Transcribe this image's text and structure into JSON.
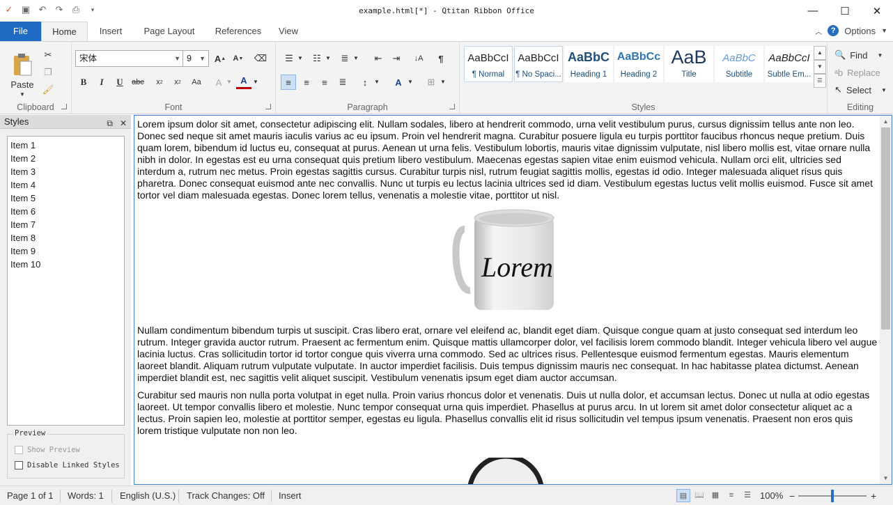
{
  "window": {
    "title": "example.html[*] - Qtitan Ribbon Office"
  },
  "ribbon_tabs": {
    "file": "File",
    "home": "Home",
    "insert": "Insert",
    "page_layout": "Page Layout",
    "references": "References",
    "view": "View"
  },
  "options_label": "Options",
  "help_glyph": "?",
  "clipboard": {
    "paste": "Paste",
    "label": "Clipboard"
  },
  "font": {
    "name": "宋体",
    "size": "9",
    "label": "Font"
  },
  "paragraph": {
    "label": "Paragraph"
  },
  "styles": {
    "label": "Styles",
    "items": [
      {
        "sample": "AaBbCcI",
        "name": "¶ Normal"
      },
      {
        "sample": "AaBbCcI",
        "name": "¶ No Spaci..."
      },
      {
        "sample": "AaBbC",
        "name": "Heading 1"
      },
      {
        "sample": "AaBbCc",
        "name": "Heading 2"
      },
      {
        "sample": "AaB",
        "name": "Title"
      },
      {
        "sample": "AaBbC",
        "name": "Subtitle"
      },
      {
        "sample": "AaBbCcI",
        "name": "Subtle Em..."
      }
    ]
  },
  "editing": {
    "find": "Find",
    "replace": "Replace",
    "select": "Select",
    "label": "Editing"
  },
  "styles_pane": {
    "title": "Styles",
    "items": [
      "Item 1",
      "Item 2",
      "Item 3",
      "Item 4",
      "Item 5",
      "Item 6",
      "Item 7",
      "Item 8",
      "Item 9",
      "Item 10"
    ],
    "preview_legend": "Preview",
    "show_preview": "Show Preview",
    "disable_linked": "Disable Linked Styles"
  },
  "document": {
    "p1": "Lorem ipsum dolor sit amet, consectetur adipiscing elit. Nullam sodales, libero at hendrerit commodo, urna velit vestibulum purus, cursus dignissim tellus ante non leo. Donec sed neque sit amet mauris iaculis varius ac eu ipsum. Proin vel hendrerit magna. Curabitur posuere ligula eu turpis porttitor faucibus rhoncus neque pretium. Duis quam lorem, bibendum id luctus eu, consequat at purus. Aenean ut urna felis. Vestibulum lobortis, mauris vitae dignissim vulputate, nisl libero mollis est, vitae ornare nulla nibh in dolor. In egestas est eu urna consequat quis pretium libero vestibulum. Maecenas egestas sapien vitae enim euismod vehicula. Nullam orci elit, ultricies sed interdum a, rutrum nec metus. Proin egestas sagittis cursus. Curabitur turpis nisl, rutrum feugiat sagittis mollis, egestas id odio. Integer malesuada aliquet risus quis pharetra. Donec consequat euismod ante nec convallis. Nunc ut turpis eu lectus lacinia ultrices sed id diam. Vestibulum egestas luctus velit mollis euismod. Fusce sit amet tortor vel diam malesuada egestas. Donec lorem tellus, venenatis a molestie vitae, porttitor ut nisl.",
    "mug_text": "Lorem",
    "p2": "Nullam condimentum bibendum turpis ut suscipit. Cras libero erat, ornare vel eleifend ac, blandit eget diam. Quisque congue quam at justo consequat sed interdum leo rutrum. Integer gravida auctor rutrum. Praesent ac fermentum enim. Quisque mattis ullamcorper dolor, vel facilisis lorem commodo blandit. Integer vehicula libero vel augue lacinia luctus. Cras sollicitudin tortor id tortor congue quis viverra urna commodo. Sed ac ultrices risus. Pellentesque euismod fermentum egestas. Mauris elementum laoreet blandit. Aliquam rutrum vulputate vulputate. In auctor imperdiet facilisis. Duis tempus dignissim mauris nec consequat. In hac habitasse platea dictumst. Aenean imperdiet blandit est, nec sagittis velit aliquet suscipit. Vestibulum venenatis ipsum eget diam auctor accumsan.",
    "p3": "Curabitur sed mauris non nulla porta volutpat in eget nulla. Proin varius rhoncus dolor et venenatis. Duis ut nulla dolor, et accumsan lectus. Donec ut nulla at odio egestas laoreet. Ut tempor convallis libero et molestie. Nunc tempor consequat urna quis imperdiet. Phasellus at purus arcu. In ut lorem sit amet dolor consectetur aliquet ac a lectus. Proin sapien leo, molestie at porttitor semper, egestas eu ligula. Phasellus convallis elit id risus sollicitudin vel tempus ipsum venenatis. Praesent non eros quis lorem tristique vulputate non non leo."
  },
  "status": {
    "page": "Page 1 of 1",
    "words": "Words: 1",
    "language": "English (U.S.)",
    "track": "Track Changes: Off",
    "mode": "Insert",
    "zoom": "100%",
    "zoom_fraction": 0.5
  },
  "colors": {
    "accent": "#1f6bc3",
    "font_color": "#c00000"
  }
}
